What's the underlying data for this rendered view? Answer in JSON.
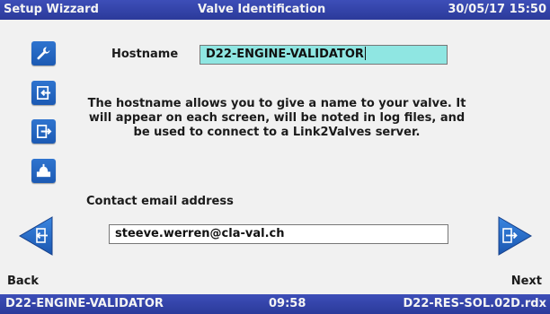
{
  "header": {
    "app_title": "Setup Wizzard",
    "screen_title": "Valve Identification",
    "datetime": "30/05/17 15:50"
  },
  "sidebar": {
    "items": [
      {
        "icon": "wrench-icon"
      },
      {
        "icon": "import-icon"
      },
      {
        "icon": "export-icon"
      },
      {
        "icon": "valve-icon"
      }
    ]
  },
  "form": {
    "hostname_label": "Hostname",
    "hostname_value": "D22-ENGINE-VALIDATOR",
    "info_text": "The hostname allows you to give a name to your valve. It will appear on each screen, will be noted in log files, and be used to connect to a Link2Valves server.",
    "email_label": "Contact email address",
    "email_value": "steeve.werren@cla-val.ch"
  },
  "nav": {
    "back_label": "Back",
    "next_label": "Next"
  },
  "footer": {
    "hostname": "D22-ENGINE-VALIDATOR",
    "time": "09:58",
    "file": "D22-RES-SOL.02D.rdx"
  },
  "colors": {
    "bar": "#2b3a9a",
    "button": "#1c5ab3",
    "hostname_field": "#8fe6e2"
  }
}
